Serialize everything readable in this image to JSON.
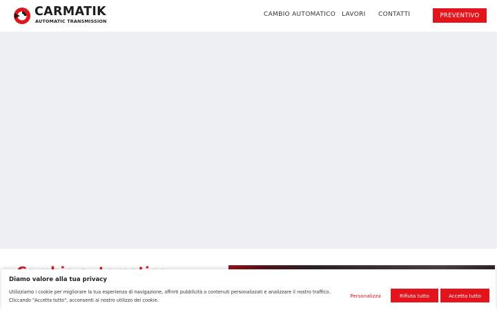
{
  "header": {
    "logo": {
      "name": "CARMATIK",
      "tagline": "AUTOMATIC TRANSMISSION",
      "mark_icon": "carmatik-gear-logo-icon"
    },
    "nav": [
      {
        "label": "CAMBIO AUTOMATICO"
      },
      {
        "label": "LAVORI"
      },
      {
        "label": "CONTATTI"
      }
    ],
    "cta_label": "PREVENTIVO"
  },
  "section": {
    "title": "Cambio automatico"
  },
  "cookie": {
    "title": "Diamo valore alla tua privacy",
    "text_line1": "Utilizziamo i cookie per migliorare la tua esperienza di navigazione, offrirti pubblicità o contenuti personalizzati e analizzare il nostro traffico.",
    "text_line2": "Cliccando \"Accetta tutto\", acconsenti al nostro utilizzo dei cookie.",
    "customize_label": "Personalizza",
    "reject_label": "Rifiuta tutto",
    "accept_label": "Accetta tutto"
  },
  "colors": {
    "accent": "#e3141c",
    "hero_bg": "#eef0f4",
    "text_dark": "#1c1c1c"
  }
}
